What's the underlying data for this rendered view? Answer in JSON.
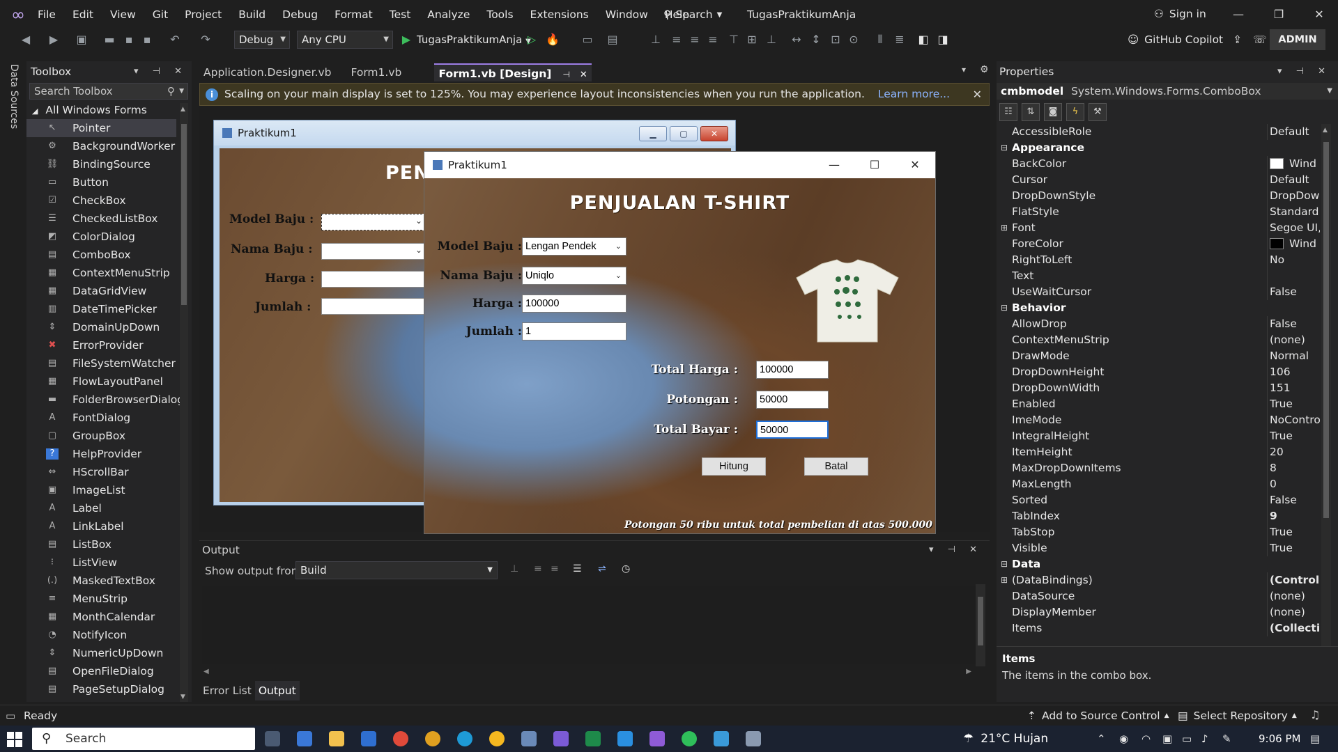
{
  "menubar": {
    "items": [
      "File",
      "Edit",
      "View",
      "Git",
      "Project",
      "Build",
      "Debug",
      "Format",
      "Test",
      "Analyze",
      "Tools",
      "Extensions",
      "Window",
      "Help"
    ],
    "search_label": "Search",
    "solution_name": "TugasPraktikumAnja",
    "sign_in": "Sign in"
  },
  "toolbar": {
    "config": "Debug",
    "platform": "Any CPU",
    "startup_project": "TugasPraktikumAnja",
    "copilot": "GitHub Copilot",
    "admin_badge": "ADMIN"
  },
  "left_strip": {
    "data_sources": "Data Sources"
  },
  "toolbox": {
    "title": "Toolbox",
    "search_placeholder": "Search Toolbox",
    "group": "All Windows Forms",
    "items": [
      {
        "label": "Pointer",
        "icon": "pointer-icon",
        "glyph": "↖"
      },
      {
        "label": "BackgroundWorker",
        "icon": "background-worker-icon",
        "glyph": "⚙"
      },
      {
        "label": "BindingSource",
        "icon": "binding-source-icon",
        "glyph": "⛓"
      },
      {
        "label": "Button",
        "icon": "button-icon",
        "glyph": "▭"
      },
      {
        "label": "CheckBox",
        "icon": "checkbox-icon",
        "glyph": "☑"
      },
      {
        "label": "CheckedListBox",
        "icon": "checked-list-box-icon",
        "glyph": "☰"
      },
      {
        "label": "ColorDialog",
        "icon": "color-dialog-icon",
        "glyph": "◩"
      },
      {
        "label": "ComboBox",
        "icon": "combobox-icon",
        "glyph": "▤"
      },
      {
        "label": "ContextMenuStrip",
        "icon": "context-menu-strip-icon",
        "glyph": "▦"
      },
      {
        "label": "DataGridView",
        "icon": "data-grid-view-icon",
        "glyph": "▦"
      },
      {
        "label": "DateTimePicker",
        "icon": "date-time-picker-icon",
        "glyph": "▥"
      },
      {
        "label": "DomainUpDown",
        "icon": "domain-up-down-icon",
        "glyph": "⇕"
      },
      {
        "label": "ErrorProvider",
        "icon": "error-provider-icon",
        "glyph": "✖"
      },
      {
        "label": "FileSystemWatcher",
        "icon": "file-system-watcher-icon",
        "glyph": "▤"
      },
      {
        "label": "FlowLayoutPanel",
        "icon": "flow-layout-panel-icon",
        "glyph": "▦"
      },
      {
        "label": "FolderBrowserDialog",
        "icon": "folder-browser-dialog-icon",
        "glyph": "▬"
      },
      {
        "label": "FontDialog",
        "icon": "font-dialog-icon",
        "glyph": "A"
      },
      {
        "label": "GroupBox",
        "icon": "groupbox-icon",
        "glyph": "▢"
      },
      {
        "label": "HelpProvider",
        "icon": "help-provider-icon",
        "glyph": "?"
      },
      {
        "label": "HScrollBar",
        "icon": "hscrollbar-icon",
        "glyph": "⇔"
      },
      {
        "label": "ImageList",
        "icon": "image-list-icon",
        "glyph": "▣"
      },
      {
        "label": "Label",
        "icon": "label-icon",
        "glyph": "A"
      },
      {
        "label": "LinkLabel",
        "icon": "link-label-icon",
        "glyph": "A"
      },
      {
        "label": "ListBox",
        "icon": "listbox-icon",
        "glyph": "▤"
      },
      {
        "label": "ListView",
        "icon": "listview-icon",
        "glyph": "⁝"
      },
      {
        "label": "MaskedTextBox",
        "icon": "masked-textbox-icon",
        "glyph": "(.)"
      },
      {
        "label": "MenuStrip",
        "icon": "menu-strip-icon",
        "glyph": "≡"
      },
      {
        "label": "MonthCalendar",
        "icon": "month-calendar-icon",
        "glyph": "▦"
      },
      {
        "label": "NotifyIcon",
        "icon": "notify-icon-icon",
        "glyph": "◔"
      },
      {
        "label": "NumericUpDown",
        "icon": "numeric-up-down-icon",
        "glyph": "⇕"
      },
      {
        "label": "OpenFileDialog",
        "icon": "open-file-dialog-icon",
        "glyph": "▤"
      },
      {
        "label": "PageSetupDialog",
        "icon": "page-setup-dialog-icon",
        "glyph": "▤"
      }
    ]
  },
  "doc_tabs": [
    {
      "label": "Application.Designer.vb",
      "active": false
    },
    {
      "label": "Form1.vb",
      "active": false
    },
    {
      "label": "Form1.vb [Design]",
      "active": true
    }
  ],
  "infobar": {
    "message": "Scaling on your main display is set to 125%. You may experience layout inconsistencies when you run the application.",
    "link": "Learn more..."
  },
  "back_form": {
    "title": "Praktikum1",
    "heading": "PENJ",
    "labels": [
      "Model Baju :",
      "Nama Baju :",
      "Harga :",
      "Jumlah :"
    ]
  },
  "front_form": {
    "title": "Praktikum1",
    "heading": "PENJUALAN T-SHIRT",
    "model_label": "Model Baju :",
    "model_value": "Lengan Pendek",
    "nama_label": "Nama Baju :",
    "nama_value": "Uniqlo",
    "harga_label": "Harga :",
    "harga_value": "100000",
    "jumlah_label": "Jumlah :",
    "jumlah_value": "1",
    "total_harga_label": "Total Harga :",
    "total_harga_value": "100000",
    "potongan_label": "Potongan :",
    "potongan_value": "50000",
    "total_bayar_label": "Total Bayar :",
    "total_bayar_value": "50000",
    "hitung_label": "Hitung",
    "batal_label": "Batal",
    "footnote": "Potongan 50 ribu untuk total pembelian di atas 500.000"
  },
  "output": {
    "title": "Output",
    "show_from_label": "Show output from:",
    "source": "Build"
  },
  "bottom_tabs": [
    {
      "label": "Error List",
      "active": false
    },
    {
      "label": "Output",
      "active": true
    }
  ],
  "properties": {
    "title": "Properties",
    "object_name": "cmbmodel",
    "object_type": "System.Windows.Forms.ComboBox",
    "rows": [
      {
        "kind": "prop",
        "name": "AccessibleRole",
        "value": "Default"
      },
      {
        "kind": "cat",
        "name": "Appearance"
      },
      {
        "kind": "prop",
        "name": "BackColor",
        "value": "Wind",
        "swatch": "#ffffff"
      },
      {
        "kind": "prop",
        "name": "Cursor",
        "value": "Default"
      },
      {
        "kind": "prop",
        "name": "DropDownStyle",
        "value": "DropDow"
      },
      {
        "kind": "prop",
        "name": "FlatStyle",
        "value": "Standard"
      },
      {
        "kind": "prop",
        "name": "Font",
        "value": "Segoe UI,",
        "expand": true
      },
      {
        "kind": "prop",
        "name": "ForeColor",
        "value": "Wind",
        "swatch": "#000000"
      },
      {
        "kind": "prop",
        "name": "RightToLeft",
        "value": "No"
      },
      {
        "kind": "prop",
        "name": "Text",
        "value": ""
      },
      {
        "kind": "prop",
        "name": "UseWaitCursor",
        "value": "False"
      },
      {
        "kind": "cat",
        "name": "Behavior"
      },
      {
        "kind": "prop",
        "name": "AllowDrop",
        "value": "False"
      },
      {
        "kind": "prop",
        "name": "ContextMenuStrip",
        "value": "(none)"
      },
      {
        "kind": "prop",
        "name": "DrawMode",
        "value": "Normal"
      },
      {
        "kind": "prop",
        "name": "DropDownHeight",
        "value": "106"
      },
      {
        "kind": "prop",
        "name": "DropDownWidth",
        "value": "151"
      },
      {
        "kind": "prop",
        "name": "Enabled",
        "value": "True"
      },
      {
        "kind": "prop",
        "name": "ImeMode",
        "value": "NoControl"
      },
      {
        "kind": "prop",
        "name": "IntegralHeight",
        "value": "True"
      },
      {
        "kind": "prop",
        "name": "ItemHeight",
        "value": "20"
      },
      {
        "kind": "prop",
        "name": "MaxDropDownItems",
        "value": "8"
      },
      {
        "kind": "prop",
        "name": "MaxLength",
        "value": "0"
      },
      {
        "kind": "prop",
        "name": "Sorted",
        "value": "False"
      },
      {
        "kind": "prop",
        "name": "TabIndex",
        "value": "9",
        "bold": true
      },
      {
        "kind": "prop",
        "name": "TabStop",
        "value": "True"
      },
      {
        "kind": "prop",
        "name": "Visible",
        "value": "True"
      },
      {
        "kind": "cat",
        "name": "Data"
      },
      {
        "kind": "prop",
        "name": "(DataBindings)",
        "value": "(ControlB",
        "bold": true,
        "expand": true
      },
      {
        "kind": "prop",
        "name": "DataSource",
        "value": "(none)"
      },
      {
        "kind": "prop",
        "name": "DisplayMember",
        "value": "(none)"
      },
      {
        "kind": "prop",
        "name": "Items",
        "value": "(Collectio",
        "bold": true
      }
    ],
    "desc_title": "Items",
    "desc_text": "The items in the combo box."
  },
  "statusbar": {
    "ready": "Ready",
    "add_source": "Add to Source Control",
    "select_repo": "Select Repository"
  },
  "taskbar": {
    "search": "Search",
    "weather": "21°C Hujan",
    "time": "9:06 PM"
  },
  "colors": {
    "accent": "#9d7ee6",
    "infobar": "#3d3721",
    "taskbar": "#1b2230"
  }
}
